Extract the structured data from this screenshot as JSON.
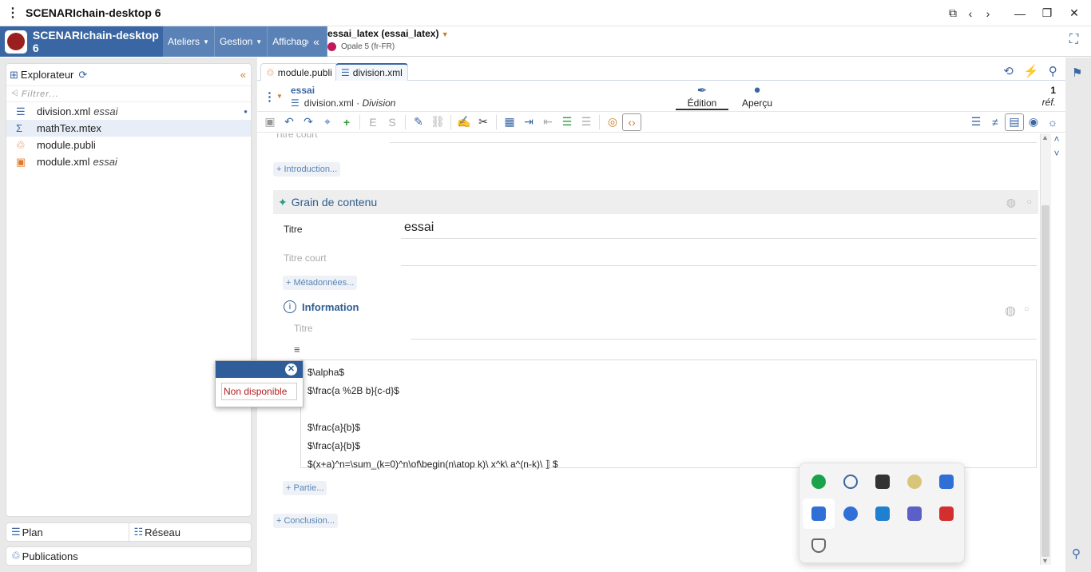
{
  "window": {
    "title": "SCENARIchain-desktop 6"
  },
  "app": {
    "brand": "SCENARIchain-desktop 6",
    "menus": [
      "Ateliers",
      "Gestion",
      "Affichage"
    ],
    "project_name": "essai_latex (essai_latex)",
    "project_model": "Opale 5 (fr-FR)"
  },
  "explorer": {
    "title": "Explorateur",
    "filter_placeholder": "Filtrer...",
    "files": [
      {
        "name": "division.xml",
        "tag": "essai",
        "icon": "division-icon"
      },
      {
        "name": "mathTex.mtex",
        "tag": "",
        "icon": "sigma-icon"
      },
      {
        "name": "module.publi",
        "tag": "",
        "icon": "publication-icon"
      },
      {
        "name": "module.xml",
        "tag": "essai",
        "icon": "module-icon"
      }
    ]
  },
  "bottom_panels": {
    "plan": "Plan",
    "reseau": "Réseau",
    "publications": "Publications"
  },
  "tabs": [
    {
      "label": "module.publi"
    },
    {
      "label": "division.xml"
    }
  ],
  "doc": {
    "name": "essai",
    "file": "division.xml",
    "file_type": "Division",
    "mode_edit": "Édition",
    "mode_preview": "Aperçu",
    "ref_count": "1",
    "ref_label": "réf."
  },
  "content": {
    "titre_court_top": "Titre court",
    "intro_link": "+ Introduction...",
    "grain_title": "Grain de contenu",
    "titre_label": "Titre",
    "titre_value": "essai",
    "titre_court_label": "Titre court",
    "meta_link": "+ Métadonnées...",
    "info_title": "Information",
    "info_titre_label": "Titre",
    "math_lines": [
      "$\\alpha$",
      "$\\frac{a %2B b}{c-d}$",
      "",
      "$\\frac{a}{b}$",
      "$\\frac{a}{b}$",
      "$(x+a)^n=\\sum_(k=0)^n\\of\\begin(n\\atop k)\\ x^k\\ a^(n-k)\\ ⟧ $"
    ],
    "partie_link": "+ Partie...",
    "conclusion_link": "+ Conclusion..."
  },
  "popup": {
    "message": "Non disponible"
  },
  "colors": {
    "brand_blue": "#3a67a3",
    "menu_blue": "#5a82b6",
    "error_red": "#b01e1e"
  }
}
